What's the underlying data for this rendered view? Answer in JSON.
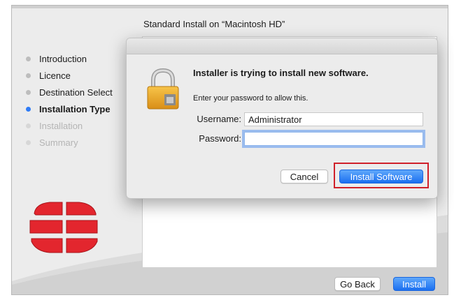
{
  "installer": {
    "title": "Standard Install on “Macintosh HD”",
    "steps": [
      {
        "label": "Introduction",
        "state": "done"
      },
      {
        "label": "Licence",
        "state": "done"
      },
      {
        "label": "Destination Select",
        "state": "done"
      },
      {
        "label": "Installation Type",
        "state": "current"
      },
      {
        "label": "Installation",
        "state": "pending"
      },
      {
        "label": "Summary",
        "state": "pending"
      }
    ],
    "go_back_label": "Go Back",
    "install_label": "Install"
  },
  "dialog": {
    "title": "Installer is trying to install new software.",
    "subtitle": "Enter your password to allow this.",
    "username_label": "Username:",
    "username_value": "Administrator",
    "password_label": "Password:",
    "password_value": "",
    "cancel_label": "Cancel",
    "install_software_label": "Install Software"
  },
  "colors": {
    "accent": "#2f7cf6",
    "highlight_box": "#d0202a",
    "logo_red": "#e3262e"
  },
  "icons": [
    "lock-icon",
    "fortinet-logo"
  ]
}
